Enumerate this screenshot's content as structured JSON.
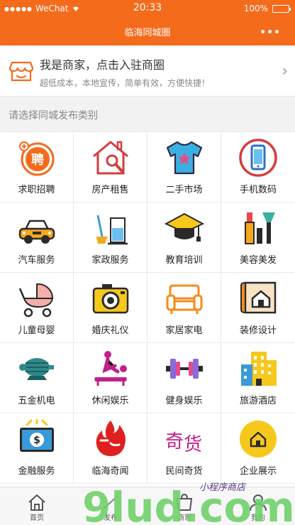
{
  "status_bar": {
    "carrier": "WeChat",
    "time": "20:33",
    "battery": "100%"
  },
  "nav": {
    "title": "临海同城圈",
    "more_icon": "more-dots-icon"
  },
  "merchant": {
    "title": "我是商家，点击入驻商圈",
    "subtitle": "超低成本，本地宣传，简单有效，方便快捷！",
    "icon": "shop-icon"
  },
  "section": {
    "label": "请选择同城发布类别"
  },
  "categories": [
    {
      "label": "求职招聘",
      "icon": "job-icon"
    },
    {
      "label": "房产租售",
      "icon": "house-icon"
    },
    {
      "label": "二手市场",
      "icon": "tshirt-icon"
    },
    {
      "label": "手机数码",
      "icon": "phone-icon"
    },
    {
      "label": "汽车服务",
      "icon": "car-icon"
    },
    {
      "label": "家政服务",
      "icon": "cleaning-icon"
    },
    {
      "label": "教育培训",
      "icon": "graduation-cap-icon"
    },
    {
      "label": "美容美发",
      "icon": "cosmetics-icon"
    },
    {
      "label": "儿童母婴",
      "icon": "stroller-icon"
    },
    {
      "label": "婚庆礼仪",
      "icon": "camera-icon"
    },
    {
      "label": "家居家电",
      "icon": "sofa-icon"
    },
    {
      "label": "装修设计",
      "icon": "blueprint-icon"
    },
    {
      "label": "五金机电",
      "icon": "motor-icon"
    },
    {
      "label": "休闲娱乐",
      "icon": "massage-icon"
    },
    {
      "label": "健身娱乐",
      "icon": "dumbbell-icon"
    },
    {
      "label": "旅游酒店",
      "icon": "hotel-icon"
    },
    {
      "label": "金融服务",
      "icon": "money-icon"
    },
    {
      "label": "临海奇闻",
      "icon": "flame-icon"
    },
    {
      "label": "民间奇货",
      "icon": "qihuo-logo-icon"
    },
    {
      "label": "企业展示",
      "icon": "enterprise-icon"
    }
  ],
  "tabs": [
    {
      "label": "首页",
      "icon": "home-icon"
    },
    {
      "label": "发布",
      "icon": "publish-icon"
    },
    {
      "label": "商家",
      "icon": "store-icon"
    },
    {
      "label": "我的",
      "icon": "user-icon"
    }
  ],
  "watermark": {
    "text": "9lud.com",
    "tagline": "小程序商店"
  },
  "colors": {
    "brand": "#f46b1c",
    "watermark_green": "#6fcf6a",
    "watermark_purple": "#5a3a8a"
  }
}
